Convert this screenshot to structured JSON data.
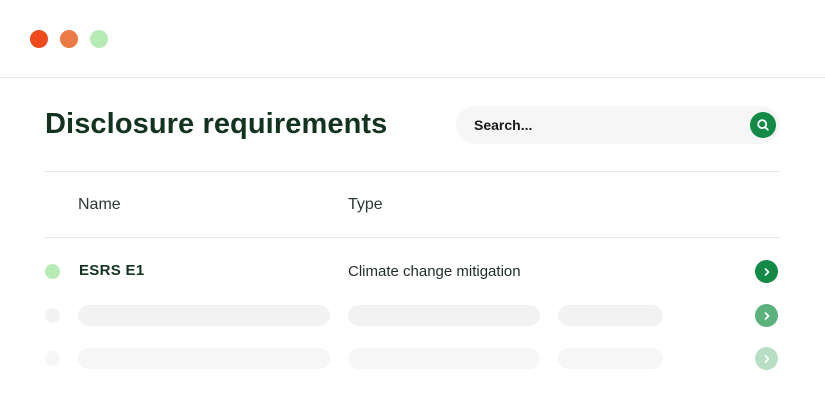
{
  "window": {
    "controls": [
      {
        "name": "close",
        "color": "#ee4a1c"
      },
      {
        "name": "minimize",
        "color": "#ec7a46"
      },
      {
        "name": "maximize",
        "color": "#b6ebb3"
      }
    ]
  },
  "header": {
    "title": "Disclosure requirements"
  },
  "search": {
    "placeholder": "Search...",
    "value": "",
    "icon": "search-icon",
    "button_color": "#138a45"
  },
  "table": {
    "columns": [
      "Name",
      "Type"
    ],
    "rows": [
      {
        "name": "ESRS E1",
        "type": "Climate change mitigation",
        "status_color": "#b6ebb3",
        "action_icon": "chevron-right-icon",
        "action_color": "#138a45"
      }
    ],
    "placeholder_rows": [
      {
        "action_icon": "chevron-right-icon",
        "action_color": "#5bb27d"
      },
      {
        "action_icon": "chevron-right-icon",
        "action_color": "#b8dfc4"
      }
    ]
  },
  "colors": {
    "title_text": "#12341f",
    "accent": "#138a45",
    "divider": "#e6e8e6",
    "skeleton": "#f1f2f1"
  }
}
